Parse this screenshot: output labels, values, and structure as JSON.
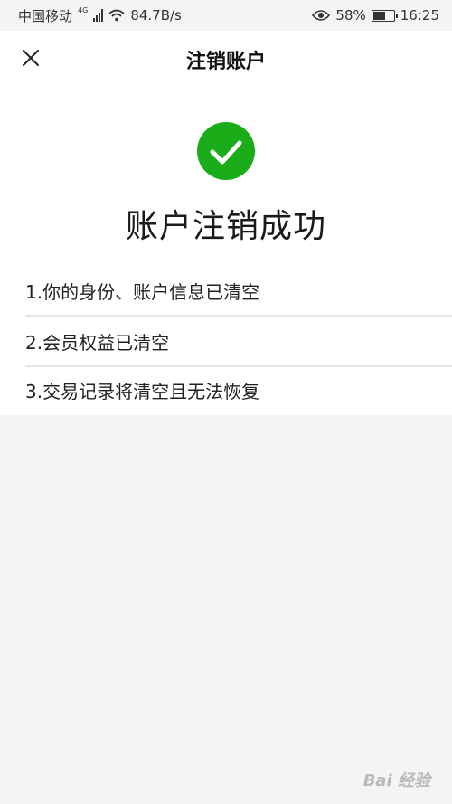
{
  "status_bar": {
    "carrier": "中国移动",
    "network": "4G",
    "speed": "84.7B/s",
    "battery": "58%",
    "battery_level": 0.58,
    "time": "16:25"
  },
  "header": {
    "title": "注销账户"
  },
  "result": {
    "title": "账户注销成功",
    "icon_color": "#1aad19"
  },
  "info_items": [
    "1.你的身份、账户信息已清空",
    "2.会员权益已清空",
    "3.交易记录将清空且无法恢复"
  ],
  "watermark": "Bai 经验"
}
